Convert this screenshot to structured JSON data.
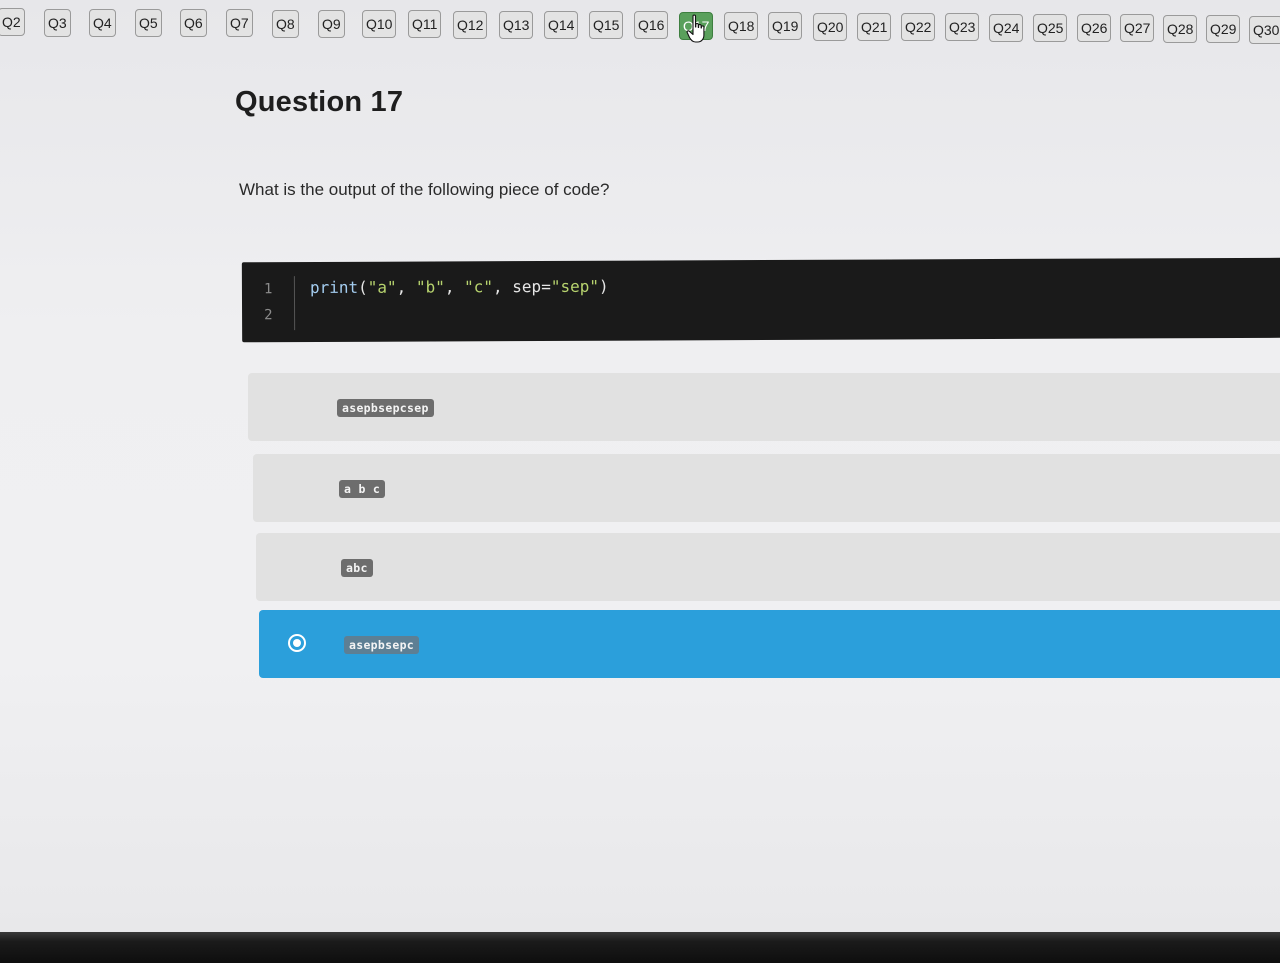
{
  "nav": {
    "questions": [
      "Q2",
      "Q3",
      "Q4",
      "Q5",
      "Q6",
      "Q7",
      "Q8",
      "Q9",
      "Q10",
      "Q11",
      "Q12",
      "Q13",
      "Q14",
      "Q15",
      "Q16",
      "Q17",
      "Q18",
      "Q19",
      "Q20",
      "Q21",
      "Q22",
      "Q23",
      "Q24",
      "Q25",
      "Q26",
      "Q27",
      "Q28",
      "Q29",
      "Q30"
    ],
    "current": "Q17",
    "accent_current": "#5aa05c"
  },
  "question": {
    "title": "Question 17",
    "text": "What is the output of the following piece of code?"
  },
  "code": {
    "line_numbers": [
      "1",
      "2"
    ],
    "tokens": {
      "fn": "print",
      "open": "(",
      "s1": "\"a\"",
      "c1": ", ",
      "s2": "\"b\"",
      "c2": ", ",
      "s3": "\"c\"",
      "c3": ", ",
      "kw": "sep=",
      "s4": "\"sep\"",
      "close": ")"
    }
  },
  "options": [
    {
      "label": "asepbsepcsep",
      "selected": false
    },
    {
      "label": "a b c",
      "selected": false
    },
    {
      "label": "abc",
      "selected": false
    },
    {
      "label": "asepbsepc",
      "selected": true
    }
  ],
  "colors": {
    "selected_option": "#2b9fdb",
    "option_bg": "#e1e1e1",
    "code_bg": "#1a1a1a"
  },
  "icons": {
    "cursor": "hand-pointer-icon",
    "radio": "radio-selected-icon"
  }
}
